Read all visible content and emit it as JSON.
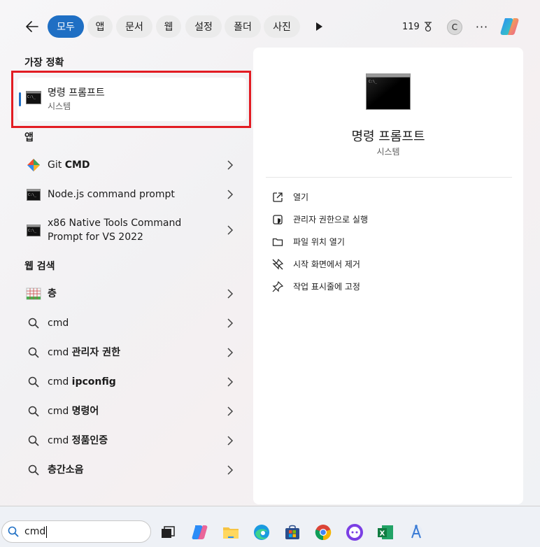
{
  "filters": {
    "items": [
      {
        "label": "모두",
        "active": true
      },
      {
        "label": "앱",
        "active": false
      },
      {
        "label": "문서",
        "active": false
      },
      {
        "label": "웹",
        "active": false
      },
      {
        "label": "설정",
        "active": false
      },
      {
        "label": "폴더",
        "active": false
      },
      {
        "label": "사진",
        "active": false
      }
    ]
  },
  "header": {
    "points": "119",
    "avatar_initial": "C",
    "more_glyph": "···"
  },
  "best_match": {
    "section_label": "가장 정확",
    "title": "명령 프롬프트",
    "subtitle": "시스템"
  },
  "apps": {
    "section_label": "앱",
    "items": [
      {
        "prefix": "Git ",
        "bold": "CMD",
        "suffix": ""
      },
      {
        "prefix": "Node.js command prompt",
        "bold": "",
        "suffix": ""
      },
      {
        "prefix": "x86 Native Tools Command",
        "bold": "",
        "suffix": "Prompt for VS 2022"
      }
    ]
  },
  "web": {
    "section_label": "웹 검색",
    "items": [
      {
        "prefix": "",
        "bold": "층"
      },
      {
        "prefix": "cmd",
        "bold": ""
      },
      {
        "prefix": "cmd ",
        "bold": "관리자 권한"
      },
      {
        "prefix": "cmd ",
        "bold": "ipconfig"
      },
      {
        "prefix": "cmd ",
        "bold": "명령어"
      },
      {
        "prefix": "cmd ",
        "bold": "정품인증"
      },
      {
        "prefix": "",
        "bold": "층간소음"
      }
    ]
  },
  "preview": {
    "title": "명령 프롬프트",
    "subtitle": "시스템",
    "actions": [
      {
        "label": "열기",
        "icon": "open-external-icon"
      },
      {
        "label": "관리자 권한으로 실행",
        "icon": "shield-admin-icon"
      },
      {
        "label": "파일 위치 열기",
        "icon": "folder-icon"
      },
      {
        "label": "시작 화면에서 제거",
        "icon": "unpin-icon"
      },
      {
        "label": "작업 표시줄에 고정",
        "icon": "pin-icon"
      }
    ]
  },
  "taskbar": {
    "search_value": "cmd",
    "apps": [
      "task-view",
      "copilot",
      "file-explorer",
      "edge",
      "store",
      "chrome",
      "messenger",
      "excel",
      "android-studio"
    ]
  },
  "colors": {
    "accent": "#1f6fc4",
    "highlight": "#e21c23"
  }
}
